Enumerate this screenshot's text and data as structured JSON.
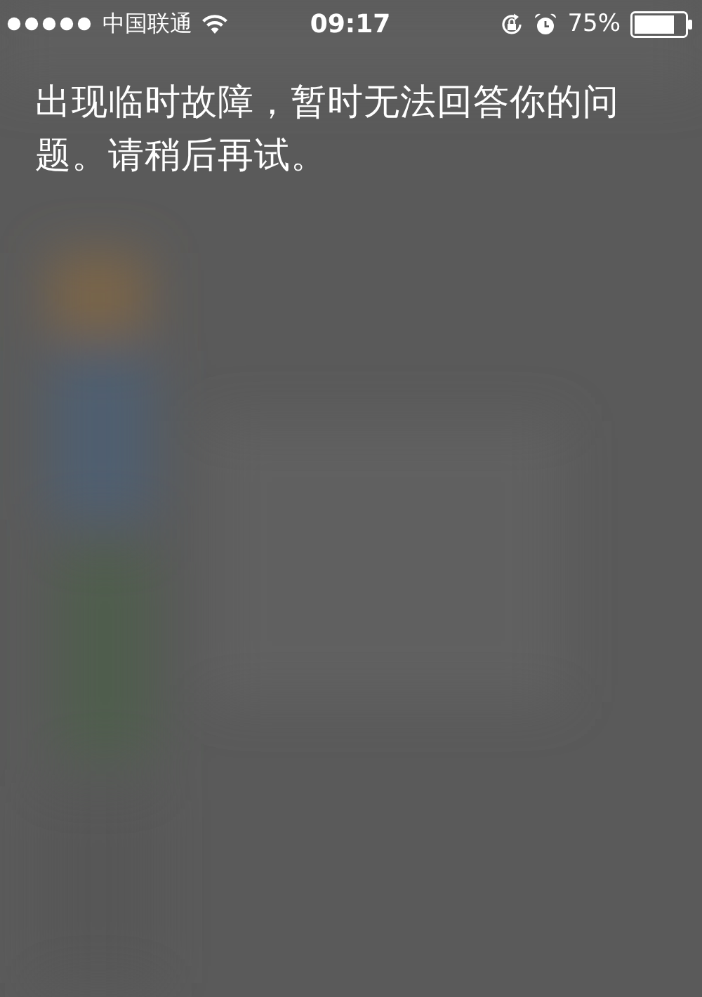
{
  "status_bar": {
    "carrier": "中国联通",
    "time": "09:17",
    "battery_percent": "75%"
  },
  "message": "出现临时故障，暂时无法回答你的问题。请稍后再试。"
}
